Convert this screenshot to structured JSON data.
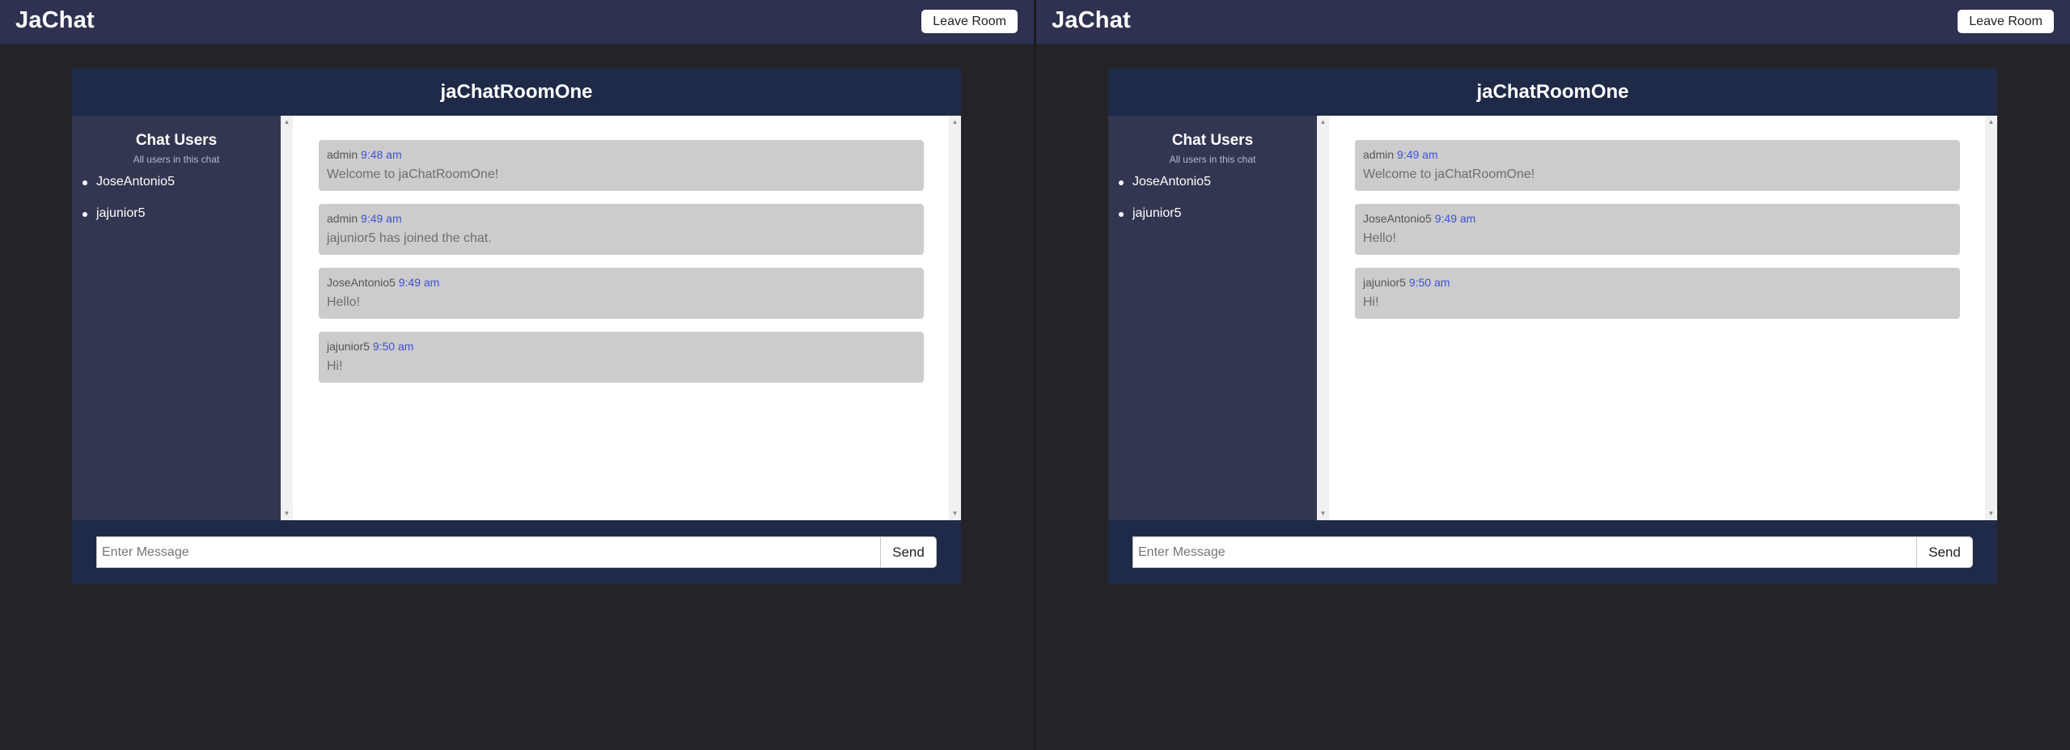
{
  "panes": [
    {
      "brand": "JaChat",
      "leave_label": "Leave Room",
      "room_name": "jaChatRoomOne",
      "sidebar": {
        "title": "Chat Users",
        "subtitle": "All users in this chat",
        "users": [
          "JoseAntonio5",
          "jajunior5"
        ]
      },
      "messages": [
        {
          "user": "admin",
          "time": "9:48 am",
          "text": "Welcome to jaChatRoomOne!"
        },
        {
          "user": "admin",
          "time": "9:49 am",
          "text": "jajunior5 has joined the chat."
        },
        {
          "user": "JoseAntonio5",
          "time": "9:49 am",
          "text": "Hello!"
        },
        {
          "user": "jajunior5",
          "time": "9:50 am",
          "text": "Hi!"
        }
      ],
      "composer": {
        "placeholder": "Enter Message",
        "send_label": "Send"
      }
    },
    {
      "brand": "JaChat",
      "leave_label": "Leave Room",
      "room_name": "jaChatRoomOne",
      "sidebar": {
        "title": "Chat Users",
        "subtitle": "All users in this chat",
        "users": [
          "JoseAntonio5",
          "jajunior5"
        ]
      },
      "messages": [
        {
          "user": "admin",
          "time": "9:49 am",
          "text": "Welcome to jaChatRoomOne!"
        },
        {
          "user": "JoseAntonio5",
          "time": "9:49 am",
          "text": "Hello!"
        },
        {
          "user": "jajunior5",
          "time": "9:50 am",
          "text": "Hi!"
        }
      ],
      "composer": {
        "placeholder": "Enter Message",
        "send_label": "Send"
      }
    }
  ],
  "colors": {
    "page_bg": "#242428",
    "topbar_bg": "#2f3150",
    "chat_box_bg": "#1e2a47",
    "sidebar_bg": "#333650",
    "message_bg": "#cccccc",
    "time_color": "#3f4fd6"
  },
  "icons": {
    "scroll_up": "scroll-up-arrow-icon",
    "scroll_down": "scroll-down-arrow-icon"
  }
}
